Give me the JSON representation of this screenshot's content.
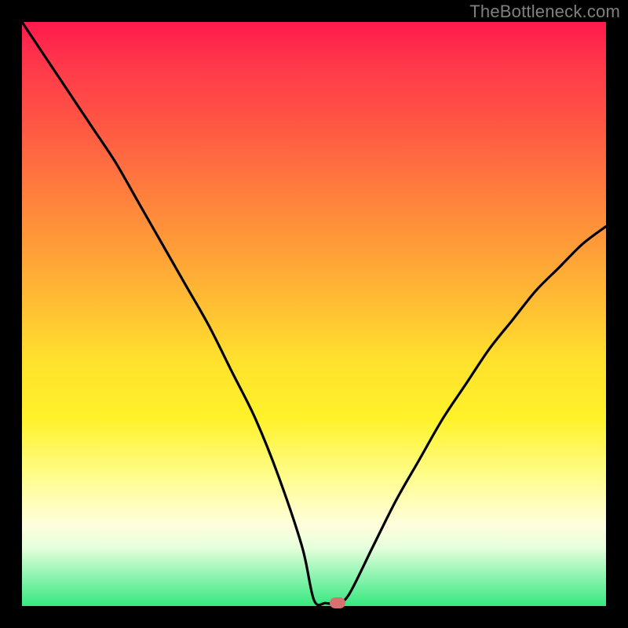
{
  "watermark": "TheBottleneck.com",
  "chart_data": {
    "type": "line",
    "title": "",
    "xlabel": "",
    "ylabel": "",
    "xlim": [
      0,
      100
    ],
    "ylim": [
      0,
      100
    ],
    "x": [
      0,
      4,
      8,
      12,
      16,
      20,
      24,
      28,
      32,
      36,
      40,
      44,
      48,
      50,
      52,
      54,
      56,
      60,
      64,
      68,
      72,
      76,
      80,
      84,
      88,
      92,
      96,
      100
    ],
    "values": [
      100,
      94,
      88,
      82,
      76,
      69,
      62,
      55,
      48,
      40,
      32,
      22,
      10,
      1,
      0.5,
      0.5,
      2,
      10,
      18,
      25,
      32,
      38,
      44,
      49,
      54,
      58,
      62,
      65
    ],
    "marker": {
      "x": 54,
      "y": 0.5
    },
    "gradient_stops": [
      {
        "pos": 0,
        "color": "#ff1a4d"
      },
      {
        "pos": 50,
        "color": "#ffe12d"
      },
      {
        "pos": 100,
        "color": "#36e87f"
      }
    ]
  }
}
